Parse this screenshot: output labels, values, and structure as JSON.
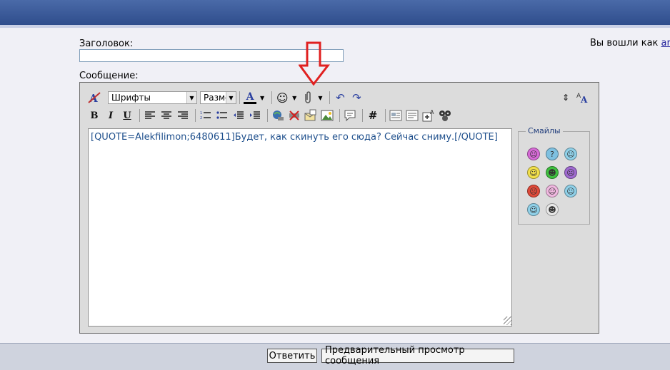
{
  "form": {
    "title_label": "Заголовок:",
    "title_value": "",
    "message_label": "Сообщение:"
  },
  "login": {
    "prefix": "Вы вошли как",
    "username": "arh"
  },
  "toolbar": {
    "font_select": "Шрифты",
    "size_select": "Разме",
    "bold": "B",
    "italic": "I",
    "underline": "U",
    "hash": "#"
  },
  "editor": {
    "content": "[QUOTE=Alekfilimon;6480611]Будет, как скинуть его сюда? Сейчас сниму.[/QUOTE]"
  },
  "smileys": {
    "title": "Смайлы",
    "items": [
      {
        "icon": "smile-pink-icon",
        "glyph": "☺",
        "color": "#d66ad6"
      },
      {
        "icon": "confused-icon",
        "glyph": "?",
        "color": "#7ec0e0"
      },
      {
        "icon": "wink-icon",
        "glyph": "☺",
        "color": "#8fd0e8"
      },
      {
        "icon": "smile-icon",
        "glyph": "☺",
        "color": "#f2e04a"
      },
      {
        "icon": "grin-icon",
        "glyph": "☻",
        "color": "#3fbf3f"
      },
      {
        "icon": "sad-icon",
        "glyph": "☹",
        "color": "#9f6ad0"
      },
      {
        "icon": "angry-icon",
        "glyph": "☹",
        "color": "#e04a3a"
      },
      {
        "icon": "tongue-icon",
        "glyph": "☺",
        "color": "#f0b8e0"
      },
      {
        "icon": "rolleyes-icon",
        "glyph": "☺",
        "color": "#8fd0e8"
      },
      {
        "icon": "cool-icon",
        "glyph": "☺",
        "color": "#8fd0e8"
      },
      {
        "icon": "eek-icon",
        "glyph": "☻",
        "color": "#e8e8e8"
      }
    ]
  },
  "buttons": {
    "reply": "Ответить",
    "preview": "Предварительный просмотр сообщения"
  },
  "colors": {
    "header": "#2f4d8c",
    "annotation_arrow": "#e02020",
    "editor_text": "#1e4f8c"
  }
}
